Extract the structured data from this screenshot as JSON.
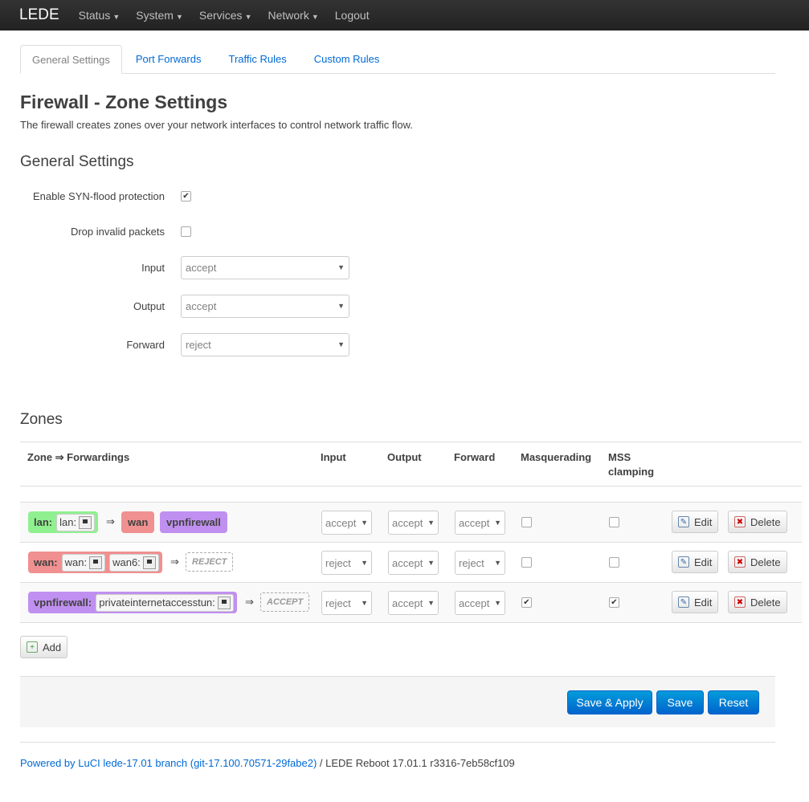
{
  "nav": {
    "brand": "LEDE",
    "items": [
      "Status",
      "System",
      "Services",
      "Network"
    ],
    "logout": "Logout"
  },
  "tabs": [
    "General Settings",
    "Port Forwards",
    "Traffic Rules",
    "Custom Rules"
  ],
  "title": "Firewall - Zone Settings",
  "description": "The firewall creates zones over your network interfaces to control network traffic flow.",
  "general": {
    "heading": "General Settings",
    "syn_label": "Enable SYN-flood protection",
    "syn_checked": true,
    "drop_label": "Drop invalid packets",
    "drop_checked": false,
    "input_label": "Input",
    "input_value": "accept",
    "output_label": "Output",
    "output_value": "accept",
    "forward_label": "Forward",
    "forward_value": "reject"
  },
  "zones": {
    "heading": "Zones",
    "headers": [
      "Zone ⇒ Forwardings",
      "Input",
      "Output",
      "Forward",
      "Masquerading",
      "MSS clamping"
    ],
    "rows": [
      {
        "name": "lan:",
        "color": "#90f090",
        "ifaces": [
          "lan:"
        ],
        "forwards": [
          {
            "label": "wan",
            "color": "#f09090"
          },
          {
            "label": "vpnfirewall",
            "color": "#c090f0"
          }
        ],
        "default": "",
        "input": "accept",
        "output": "accept",
        "forward": "accept",
        "masq": false,
        "mss": false
      },
      {
        "name": "wan:",
        "color": "#f09090",
        "ifaces": [
          "wan:",
          "wan6:"
        ],
        "forwards": [],
        "default": "REJECT",
        "input": "reject",
        "output": "accept",
        "forward": "reject",
        "masq": false,
        "mss": false
      },
      {
        "name": "vpnfirewall:",
        "color": "#c090f0",
        "ifaces": [
          "privateinternetaccesstun:"
        ],
        "forwards": [],
        "default": "ACCEPT",
        "input": "reject",
        "output": "accept",
        "forward": "accept",
        "masq": true,
        "mss": true
      }
    ],
    "edit": "Edit",
    "delete": "Delete",
    "add": "Add",
    "arrow": "⇒"
  },
  "actions": {
    "save_apply": "Save & Apply",
    "save": "Save",
    "reset": "Reset"
  },
  "footer": {
    "link": "Powered by LuCI lede-17.01 branch (git-17.100.70571-29fabe2)",
    "rest": " / LEDE Reboot 17.01.1 r3316-7eb58cf109"
  }
}
